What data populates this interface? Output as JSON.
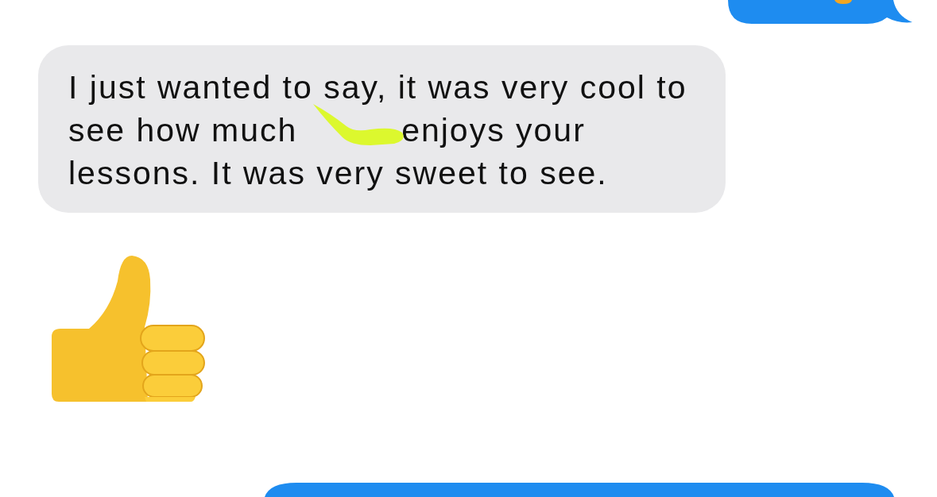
{
  "messages": [
    {
      "kind": "sent"
    },
    {
      "kind": "received",
      "text": "I just wanted to say, it was very cool to see how much",
      "redacted": true,
      "text_after": "enjoys your lessons. It was very sweet to see."
    },
    {
      "kind": "sticker"
    },
    {
      "kind": "sent"
    }
  ]
}
